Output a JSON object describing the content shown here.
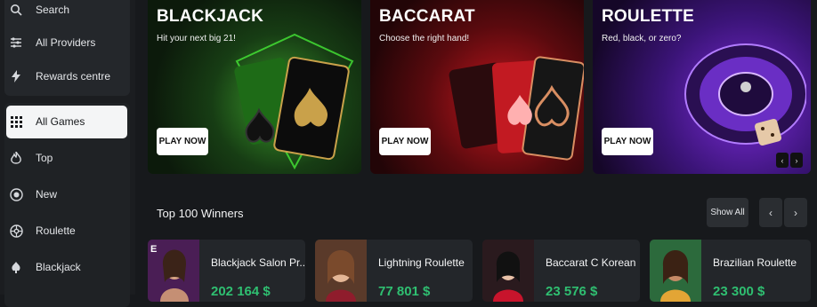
{
  "sidebar": {
    "top_items": [
      {
        "label": "Search",
        "icon": "search-icon"
      },
      {
        "label": "All Providers",
        "icon": "sliders-icon"
      },
      {
        "label": "Rewards centre",
        "icon": "lightning-icon"
      }
    ],
    "categories": [
      {
        "label": "All Games",
        "icon": "grid-icon",
        "active": true
      },
      {
        "label": "Top",
        "icon": "flame-icon"
      },
      {
        "label": "New",
        "icon": "new-badge-icon"
      },
      {
        "label": "Roulette",
        "icon": "roulette-icon"
      },
      {
        "label": "Blackjack",
        "icon": "card-icon"
      }
    ]
  },
  "promos": [
    {
      "title": "BLACKJACK",
      "subtitle": "Hit your next big 21!",
      "button": "PLAY NOW"
    },
    {
      "title": "BACCARAT",
      "subtitle": "Choose the right hand!",
      "button": "PLAY NOW"
    },
    {
      "title": "ROULETTE",
      "subtitle": "Red, black, or zero?",
      "button": "PLAY NOW"
    }
  ],
  "winners": {
    "title": "Top 100 Winners",
    "show_all": "Show All",
    "items": [
      {
        "name": "Blackjack Salon Pr...",
        "amount": "202 164 $"
      },
      {
        "name": "Lightning Roulette",
        "amount": "77 801 $"
      },
      {
        "name": "Baccarat C Korean",
        "amount": "23 576 $"
      },
      {
        "name": "Brazilian Roulette",
        "amount": "23 300 $"
      }
    ]
  },
  "colors": {
    "accent_green": "#2fbf71",
    "sidebar_bg": "#1b1d20",
    "page_bg": "#17191c"
  }
}
